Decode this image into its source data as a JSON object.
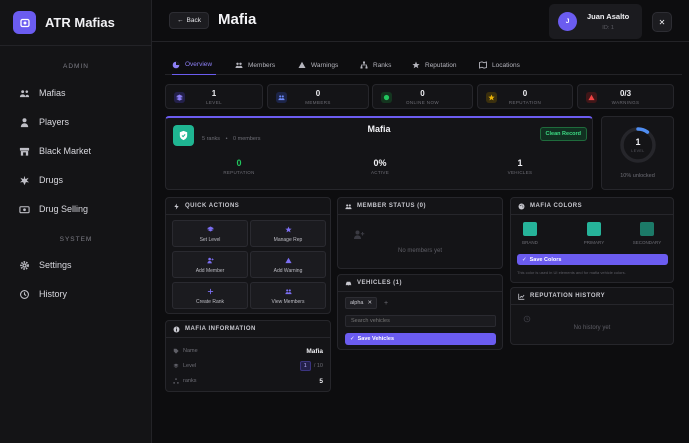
{
  "brand": {
    "title": "ATR Mafias"
  },
  "sidebar": {
    "admin_label": "ADMIN",
    "system_label": "SYSTEM",
    "items": [
      {
        "label": "Mafias",
        "icon": "users-icon"
      },
      {
        "label": "Players",
        "icon": "user-icon"
      },
      {
        "label": "Black Market",
        "icon": "store-icon"
      },
      {
        "label": "Drugs",
        "icon": "leaf-icon"
      },
      {
        "label": "Drug Selling",
        "icon": "money-icon"
      }
    ],
    "system_items": [
      {
        "label": "Settings",
        "icon": "gear-icon"
      },
      {
        "label": "History",
        "icon": "history-icon"
      }
    ]
  },
  "header": {
    "back_label": "Back",
    "title": "Mafia",
    "user": {
      "initial": "J",
      "name": "Juan Asalto",
      "id": "ID: 1"
    },
    "close_label": "✕"
  },
  "tabs": [
    {
      "label": "Overview",
      "active": true
    },
    {
      "label": "Members"
    },
    {
      "label": "Warnings"
    },
    {
      "label": "Ranks"
    },
    {
      "label": "Reputation"
    },
    {
      "label": "Locations"
    }
  ],
  "stats": [
    {
      "value": "1",
      "label": "LEVEL",
      "color": "#6b5cf0"
    },
    {
      "value": "0",
      "label": "MEMBERS",
      "color": "#4f6ef2"
    },
    {
      "value": "0",
      "label": "ONLINE NOW",
      "color": "#22c55e"
    },
    {
      "value": "0",
      "label": "REPUTATION",
      "color": "#eab308"
    },
    {
      "value": "0/3",
      "label": "WARNINGS",
      "color": "#ef4444"
    }
  ],
  "mafia_card": {
    "name": "Mafia",
    "ranks_text": "5 ranks",
    "members_text": "0 members",
    "record_badge": "Clean Record",
    "metrics": [
      {
        "value": "0",
        "label": "REPUTATION",
        "color": "#22c55e"
      },
      {
        "value": "0%",
        "label": "ACTIVE",
        "color": "#f0f0f4"
      },
      {
        "value": "1",
        "label": "VEHICLES",
        "color": "#f0f0f4"
      }
    ]
  },
  "level_ring": {
    "value": "1",
    "label": "LEVEL",
    "caption": "10% unlocked",
    "progress": 0.1
  },
  "quick_actions": {
    "title": "QUICK ACTIONS",
    "buttons": [
      {
        "label": "Set Level",
        "icon": "layers-icon"
      },
      {
        "label": "Manage Rep",
        "icon": "star-icon"
      },
      {
        "label": "Add Member",
        "icon": "user-plus-icon"
      },
      {
        "label": "Add Warning",
        "icon": "warning-icon"
      },
      {
        "label": "Create Rank",
        "icon": "plus-icon"
      },
      {
        "label": "View Members",
        "icon": "users-icon"
      }
    ]
  },
  "mafia_info": {
    "title": "MAFIA INFORMATION",
    "rows": [
      {
        "label": "Name",
        "value": "Mafia"
      },
      {
        "label": "Level",
        "value": "1",
        "suffix": "/ 10"
      },
      {
        "label": "ranks",
        "value": "5"
      }
    ]
  },
  "member_status": {
    "title": "MEMBER STATUS (0)",
    "empty": "No members yet"
  },
  "vehicles": {
    "title": "VEHICLES (1)",
    "chips": [
      "alpha"
    ],
    "add": "+",
    "search_placeholder": "Search vehicles",
    "save_label": "Save Vehicles"
  },
  "mafia_colors": {
    "title": "MAFIA COLORS",
    "swatches": [
      {
        "label": "BRAND",
        "color": "#26b39a"
      },
      {
        "label": "PRIMARY",
        "color": "#26b39a"
      },
      {
        "label": "SECONDARY",
        "color": "#1c7a68"
      }
    ],
    "save_label": "Save Colors",
    "note": "This color is used in UI elements and for mafia vehicle colors."
  },
  "reputation_history": {
    "title": "REPUTATION HISTORY",
    "empty": "No history yet"
  }
}
